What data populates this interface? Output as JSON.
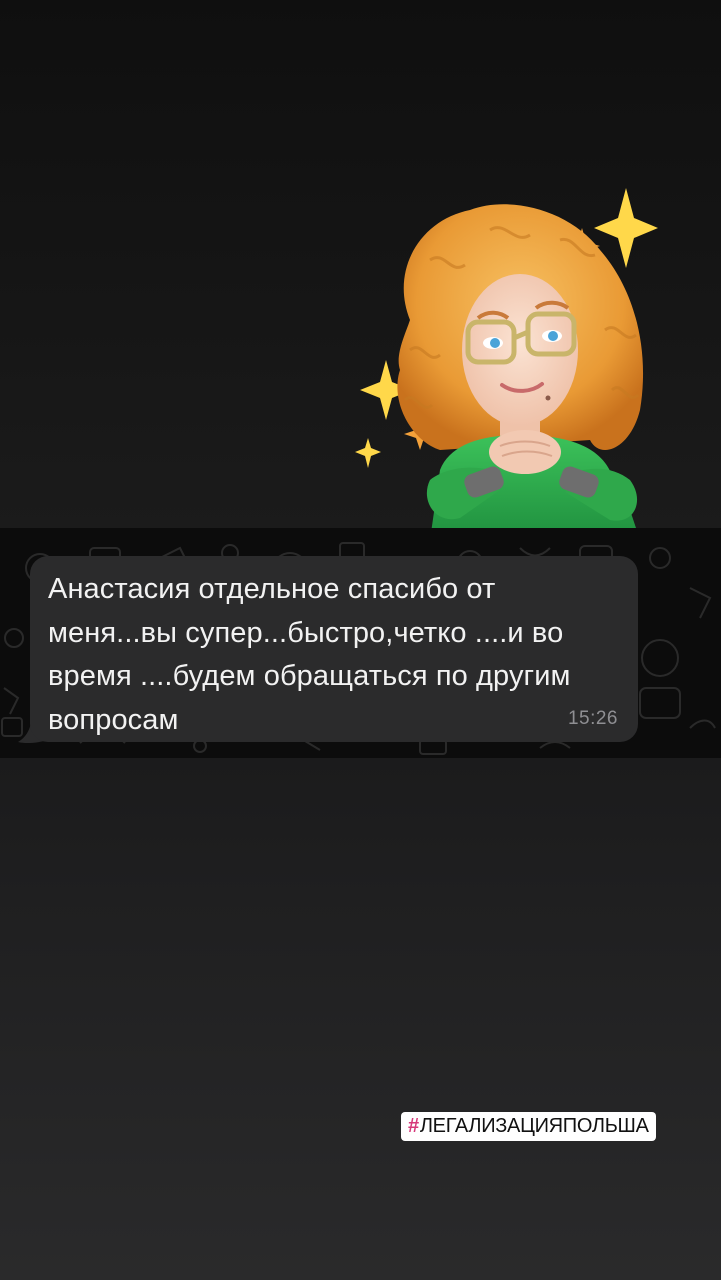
{
  "message": {
    "text": "Анастасия отдельное спасибо от меня...вы супер...быстро,четко ....и во время ....будем обращаться по другим вопросам",
    "time": "15:26"
  },
  "sticker": {
    "icon": "memoji-sticker-icon",
    "description_colors": {
      "hair": "#f0a64a",
      "sweater": "#2fa84b",
      "sparkle": "#ffd84a"
    }
  },
  "hashtag": {
    "symbol": "#",
    "text": "ЛЕГАЛИЗАЦИЯПОЛЬША"
  },
  "colors": {
    "bubble": "#2b2b2c",
    "message_text": "#f2f2f2",
    "timestamp": "#8f8f93",
    "hashtag_symbol": "#d6397a"
  }
}
